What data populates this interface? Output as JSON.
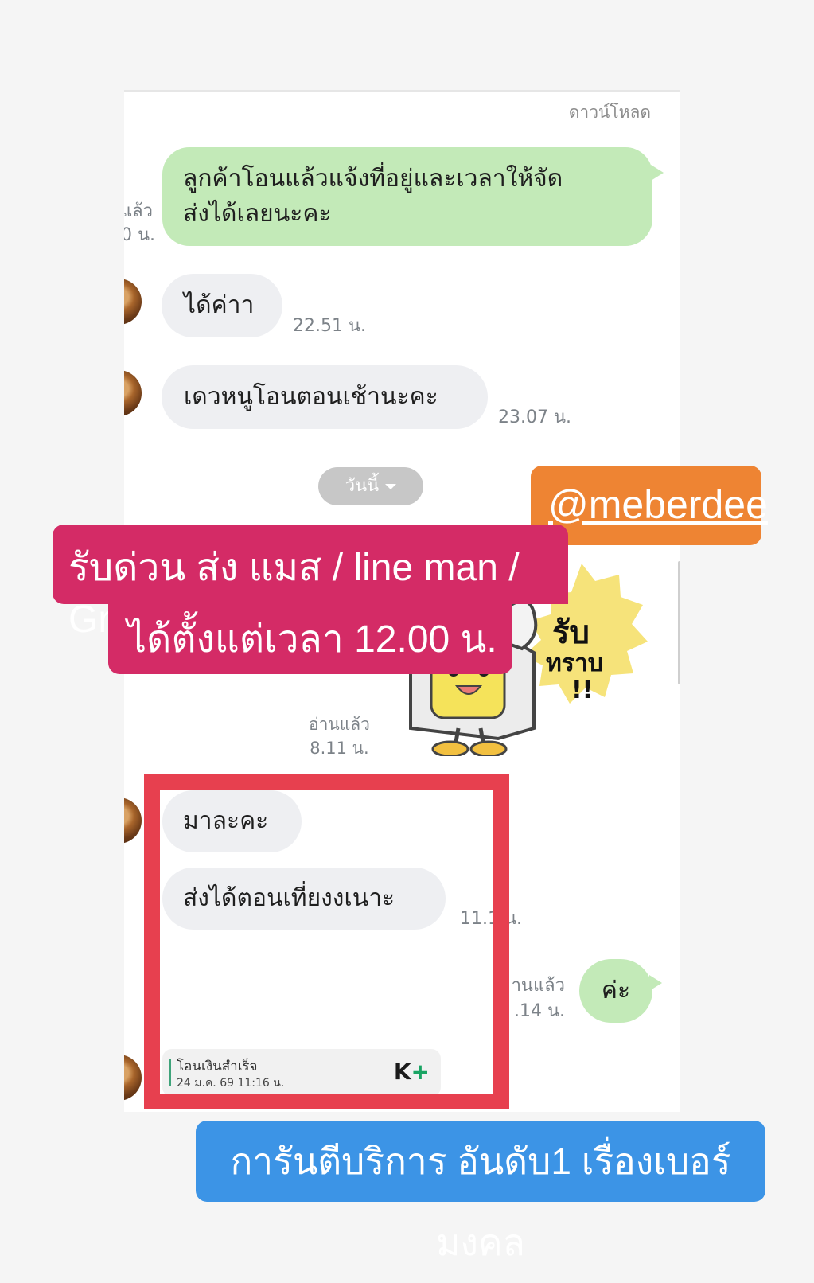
{
  "chat": {
    "download_label": "ดาวน์โหลด",
    "left_clip_read": "แล้ว",
    "left_clip_time": "0 น.",
    "msg_out_1": "ลูกค้าโอนแล้วแจ้งที่อยู่และเวลาให้จัด",
    "msg_out_1b": "ส่งได้เลยนะคะ",
    "msg_in_1": "ได้ค่าา",
    "msg_in_1_time": "22.51 น.",
    "msg_in_2": "เดวหนูโอนตอนเช้านะคะ",
    "msg_in_2_time": "23.07 น.",
    "date_divider": "วันนี้",
    "sticker_text_1": "รับ",
    "sticker_text_2": "ทราบ",
    "sticker_text_3": "!!",
    "sticker_read": "อ่านแล้ว",
    "sticker_time": "8.11 น.",
    "msg_in_3": "มาละคะ",
    "msg_in_4": "ส่งได้ตอนเที่ยงงเนาะ",
    "msg_in_4_time": "11.1   น.",
    "msg_out_2": "ค่ะ",
    "msg_out_2_read": "านแล้ว",
    "msg_out_2_time": ".14 น.",
    "transfer_title": "โอนเงินสำเร็จ",
    "transfer_date": "24 ม.ค. 69  11:16 น.",
    "transfer_logo_k": "K",
    "transfer_logo_plus": "+"
  },
  "overlays": {
    "handle": "@meberdee",
    "promo_line_1": "รับด่วน ส่ง แมส / line man / Grab",
    "promo_line_2": "ได้ตั้งแต่เวลา 12.00 น. ++",
    "guarantee": "การันตีบริการ อันดับ1 เรื่องเบอร์มงคล"
  },
  "colors": {
    "outgoing_bubble": "#c3eab8",
    "incoming_bubble": "#eeeff2",
    "promo_pink": "#d42b66",
    "handle_orange": "#ee8433",
    "guarantee_blue": "#3c94e6",
    "highlight_red": "#e7404f"
  }
}
